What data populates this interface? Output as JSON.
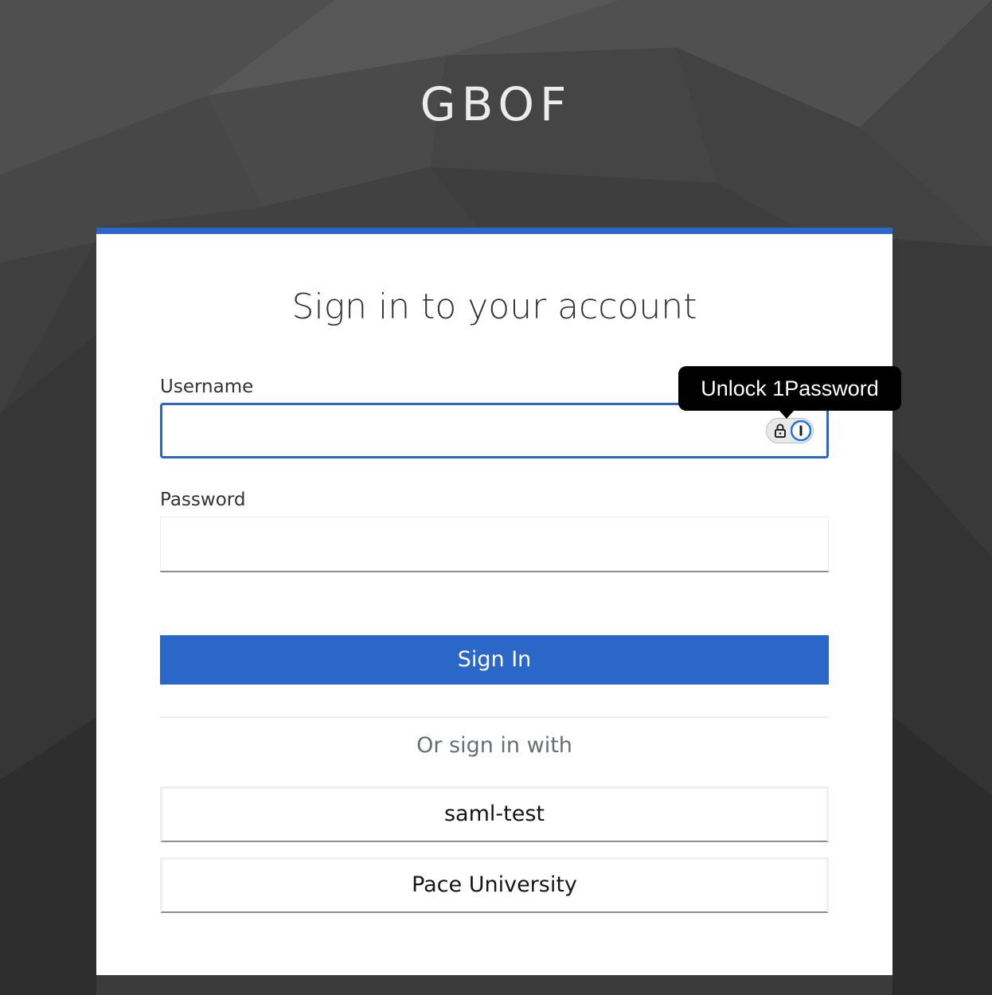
{
  "realm": {
    "title": "GBOF"
  },
  "login": {
    "heading": "Sign in to your account",
    "username_label": "Username",
    "username_value": "",
    "password_label": "Password",
    "password_value": "",
    "submit_label": "Sign In",
    "social_heading": "Or sign in with",
    "providers": [
      {
        "label": "saml-test"
      },
      {
        "label": "Pace University"
      }
    ]
  },
  "password_manager": {
    "tooltip": "Unlock 1Password",
    "lock_icon": "lock-icon",
    "logo_icon": "1password-logo-icon"
  },
  "colors": {
    "accent": "#2b67c8",
    "background": "#3a3a3a",
    "tooltip_bg": "#000000"
  }
}
